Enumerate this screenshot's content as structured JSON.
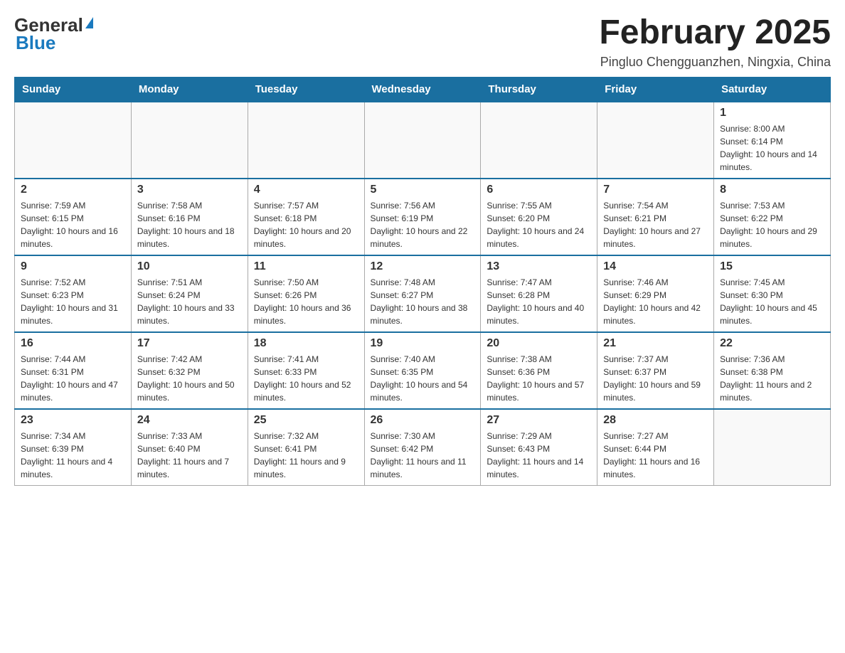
{
  "header": {
    "logo_general": "General",
    "logo_blue": "Blue",
    "title": "February 2025",
    "location": "Pingluo Chengguanzhen, Ningxia, China"
  },
  "days_of_week": [
    "Sunday",
    "Monday",
    "Tuesday",
    "Wednesday",
    "Thursday",
    "Friday",
    "Saturday"
  ],
  "weeks": [
    [
      {
        "day": "",
        "info": ""
      },
      {
        "day": "",
        "info": ""
      },
      {
        "day": "",
        "info": ""
      },
      {
        "day": "",
        "info": ""
      },
      {
        "day": "",
        "info": ""
      },
      {
        "day": "",
        "info": ""
      },
      {
        "day": "1",
        "info": "Sunrise: 8:00 AM\nSunset: 6:14 PM\nDaylight: 10 hours and 14 minutes."
      }
    ],
    [
      {
        "day": "2",
        "info": "Sunrise: 7:59 AM\nSunset: 6:15 PM\nDaylight: 10 hours and 16 minutes."
      },
      {
        "day": "3",
        "info": "Sunrise: 7:58 AM\nSunset: 6:16 PM\nDaylight: 10 hours and 18 minutes."
      },
      {
        "day": "4",
        "info": "Sunrise: 7:57 AM\nSunset: 6:18 PM\nDaylight: 10 hours and 20 minutes."
      },
      {
        "day": "5",
        "info": "Sunrise: 7:56 AM\nSunset: 6:19 PM\nDaylight: 10 hours and 22 minutes."
      },
      {
        "day": "6",
        "info": "Sunrise: 7:55 AM\nSunset: 6:20 PM\nDaylight: 10 hours and 24 minutes."
      },
      {
        "day": "7",
        "info": "Sunrise: 7:54 AM\nSunset: 6:21 PM\nDaylight: 10 hours and 27 minutes."
      },
      {
        "day": "8",
        "info": "Sunrise: 7:53 AM\nSunset: 6:22 PM\nDaylight: 10 hours and 29 minutes."
      }
    ],
    [
      {
        "day": "9",
        "info": "Sunrise: 7:52 AM\nSunset: 6:23 PM\nDaylight: 10 hours and 31 minutes."
      },
      {
        "day": "10",
        "info": "Sunrise: 7:51 AM\nSunset: 6:24 PM\nDaylight: 10 hours and 33 minutes."
      },
      {
        "day": "11",
        "info": "Sunrise: 7:50 AM\nSunset: 6:26 PM\nDaylight: 10 hours and 36 minutes."
      },
      {
        "day": "12",
        "info": "Sunrise: 7:48 AM\nSunset: 6:27 PM\nDaylight: 10 hours and 38 minutes."
      },
      {
        "day": "13",
        "info": "Sunrise: 7:47 AM\nSunset: 6:28 PM\nDaylight: 10 hours and 40 minutes."
      },
      {
        "day": "14",
        "info": "Sunrise: 7:46 AM\nSunset: 6:29 PM\nDaylight: 10 hours and 42 minutes."
      },
      {
        "day": "15",
        "info": "Sunrise: 7:45 AM\nSunset: 6:30 PM\nDaylight: 10 hours and 45 minutes."
      }
    ],
    [
      {
        "day": "16",
        "info": "Sunrise: 7:44 AM\nSunset: 6:31 PM\nDaylight: 10 hours and 47 minutes."
      },
      {
        "day": "17",
        "info": "Sunrise: 7:42 AM\nSunset: 6:32 PM\nDaylight: 10 hours and 50 minutes."
      },
      {
        "day": "18",
        "info": "Sunrise: 7:41 AM\nSunset: 6:33 PM\nDaylight: 10 hours and 52 minutes."
      },
      {
        "day": "19",
        "info": "Sunrise: 7:40 AM\nSunset: 6:35 PM\nDaylight: 10 hours and 54 minutes."
      },
      {
        "day": "20",
        "info": "Sunrise: 7:38 AM\nSunset: 6:36 PM\nDaylight: 10 hours and 57 minutes."
      },
      {
        "day": "21",
        "info": "Sunrise: 7:37 AM\nSunset: 6:37 PM\nDaylight: 10 hours and 59 minutes."
      },
      {
        "day": "22",
        "info": "Sunrise: 7:36 AM\nSunset: 6:38 PM\nDaylight: 11 hours and 2 minutes."
      }
    ],
    [
      {
        "day": "23",
        "info": "Sunrise: 7:34 AM\nSunset: 6:39 PM\nDaylight: 11 hours and 4 minutes."
      },
      {
        "day": "24",
        "info": "Sunrise: 7:33 AM\nSunset: 6:40 PM\nDaylight: 11 hours and 7 minutes."
      },
      {
        "day": "25",
        "info": "Sunrise: 7:32 AM\nSunset: 6:41 PM\nDaylight: 11 hours and 9 minutes."
      },
      {
        "day": "26",
        "info": "Sunrise: 7:30 AM\nSunset: 6:42 PM\nDaylight: 11 hours and 11 minutes."
      },
      {
        "day": "27",
        "info": "Sunrise: 7:29 AM\nSunset: 6:43 PM\nDaylight: 11 hours and 14 minutes."
      },
      {
        "day": "28",
        "info": "Sunrise: 7:27 AM\nSunset: 6:44 PM\nDaylight: 11 hours and 16 minutes."
      },
      {
        "day": "",
        "info": ""
      }
    ]
  ]
}
